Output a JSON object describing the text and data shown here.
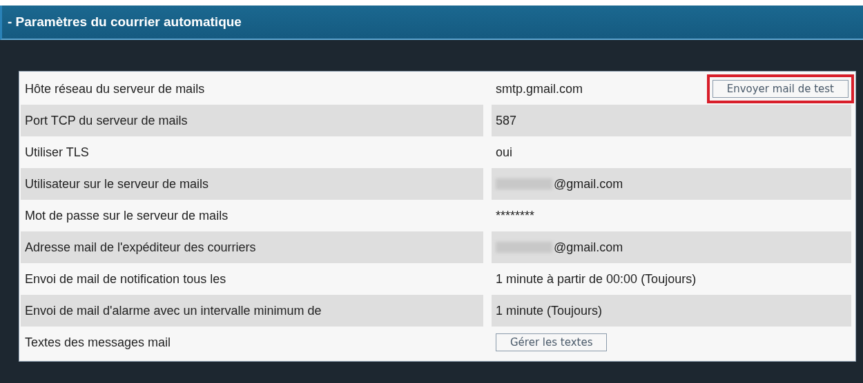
{
  "panel": {
    "title": "- Paramètres du courrier automatique"
  },
  "rows": [
    {
      "label": "Hôte réseau du serveur de mails",
      "value": "smtp.gmail.com",
      "button": {
        "label": "Envoyer mail de test",
        "highlighted": true
      }
    },
    {
      "label": "Port TCP du serveur de mails",
      "value": "587"
    },
    {
      "label": "Utiliser TLS",
      "value": "oui"
    },
    {
      "label": "Utilisateur sur le serveur de mails",
      "value": "@gmail.com",
      "redacted": true
    },
    {
      "label": "Mot de passe sur le serveur de mails",
      "value": "********"
    },
    {
      "label": "Adresse mail de l'expéditeur des courriers",
      "value": "@gmail.com",
      "redacted": true
    },
    {
      "label": "Envoi de mail de notification tous les",
      "value": "1 minute à partir de 00:00 (Toujours)"
    },
    {
      "label": "Envoi de mail d'alarme avec un intervalle minimum de",
      "value": "1 minute (Toujours)"
    },
    {
      "label": "Textes des messages mail",
      "button": {
        "label": "Gérer les textes",
        "highlighted": false
      }
    }
  ]
}
